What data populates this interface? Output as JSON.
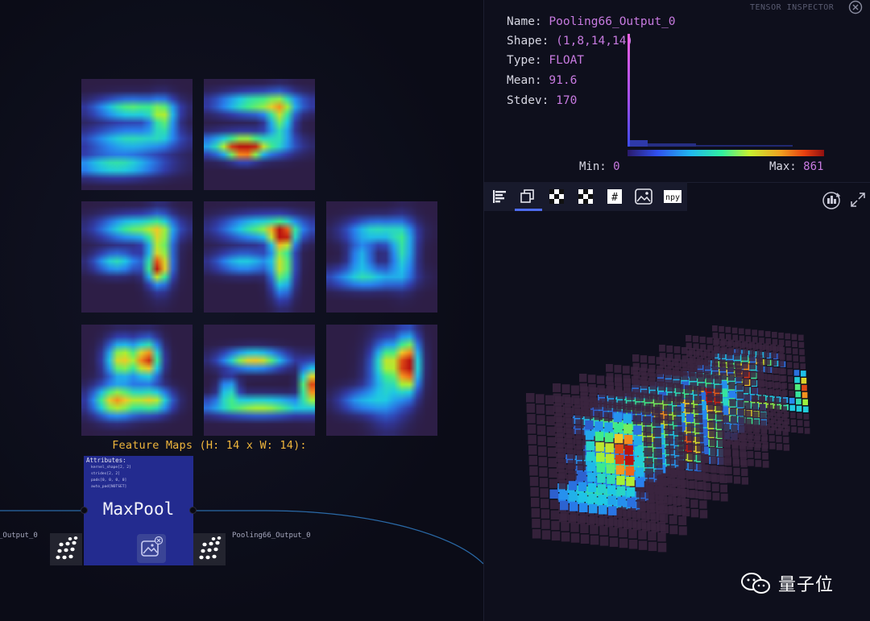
{
  "feature_maps": {
    "label": "Feature Maps (H: 14 x W: 14):",
    "height": 14,
    "width": 14,
    "count": 8
  },
  "node": {
    "title": "MaxPool",
    "attributes_title": "Attributes:",
    "attributes": [
      "kernel_shape[2, 2]",
      "strides[2, 2]",
      "pads[0, 0, 0, 0]",
      "auto_pad[NOTSET]"
    ]
  },
  "edges": {
    "input_label": "_Output_0",
    "output_label": "Pooling66_Output_0"
  },
  "inspector": {
    "title": "TENSOR INSPECTOR",
    "name_key": "Name:",
    "name": "Pooling66_Output_0",
    "shape_key": "Shape:",
    "shape": "(1,8,14,14)",
    "type_key": "Type:",
    "type": "FLOAT",
    "mean_key": "Mean:",
    "mean": "91.6",
    "stdev_key": "Stdev:",
    "stdev": "170",
    "min_key": "Min:",
    "min": "0",
    "max_key": "Max:",
    "max": "861"
  },
  "toolbar": {
    "buttons": [
      "histogram-view",
      "stack-view",
      "checker-view-1",
      "checker-view-2",
      "number-view",
      "image-view",
      "npy-export"
    ],
    "active": "stack-view",
    "npy_label": "npy",
    "number_label": "#"
  },
  "colors": {
    "accent": "#c77ae0",
    "label_orange": "#f0b63c",
    "node_blue": "#232b8f",
    "active_tab": "#4e6cf0"
  },
  "watermark": {
    "text": "量子位"
  }
}
